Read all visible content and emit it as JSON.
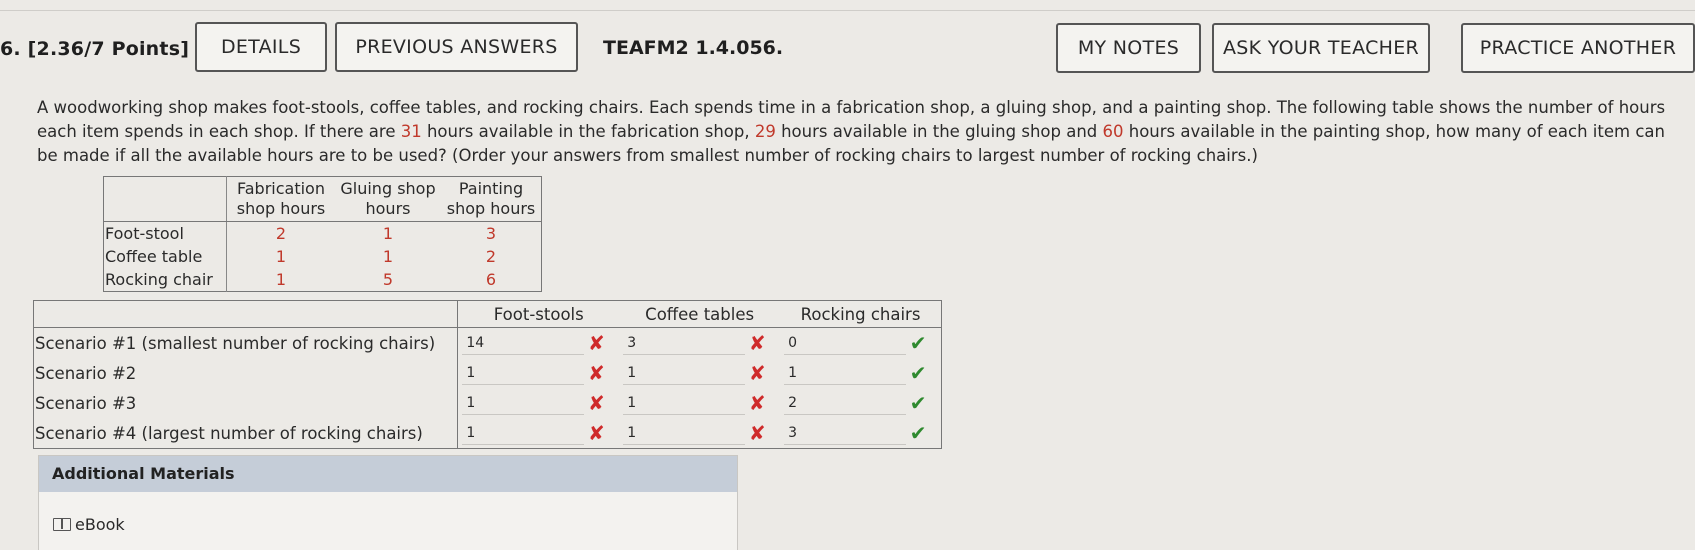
{
  "header": {
    "question_label": "6. [2.36/7 Points]",
    "details": "DETAILS",
    "previous_answers": "PREVIOUS ANSWERS",
    "problem_code": "TEAFM2 1.4.056.",
    "my_notes": "MY NOTES",
    "ask_teacher": "ASK YOUR TEACHER",
    "practice_another": "PRACTICE ANOTHER"
  },
  "prompt": {
    "p1": "A woodworking shop makes foot-stools, coffee tables, and rocking chairs. Each spends time in a fabrication shop, a gluing shop, and a painting shop. The following table shows the number of hours each item spends in each shop. If there are ",
    "fab_hours": "31",
    "p2": " hours available in the fabrication shop, ",
    "glue_hours": "29",
    "p3": " hours available in the gluing shop and ",
    "paint_hours": "60",
    "p4": " hours available in the painting shop, how many of each item can be made if all the available hours are to be used? (Order your answers from smallest number of rocking chairs to largest number of rocking chairs.)"
  },
  "hours_table": {
    "headers": [
      "Fabrication shop hours",
      "Gluing shop hours",
      "Painting shop hours"
    ],
    "rows": [
      {
        "label": "Foot-stool",
        "values": [
          "2",
          "1",
          "3"
        ]
      },
      {
        "label": "Coffee table",
        "values": [
          "1",
          "1",
          "2"
        ]
      },
      {
        "label": "Rocking chair",
        "values": [
          "1",
          "5",
          "6"
        ]
      }
    ]
  },
  "scenarios": {
    "headers": [
      "Foot-stools",
      "Coffee tables",
      "Rocking chairs"
    ],
    "rows": [
      {
        "label": "Scenario #1 (smallest number of rocking chairs)",
        "foot": "14",
        "coffee": "3",
        "rocking": "0",
        "foot_ok": false,
        "coffee_ok": false,
        "rocking_ok": true
      },
      {
        "label": "Scenario #2",
        "foot": "1",
        "coffee": "1",
        "rocking": "1",
        "foot_ok": false,
        "coffee_ok": false,
        "rocking_ok": true
      },
      {
        "label": "Scenario #3",
        "foot": "1",
        "coffee": "1",
        "rocking": "2",
        "foot_ok": false,
        "coffee_ok": false,
        "rocking_ok": true
      },
      {
        "label": "Scenario #4 (largest number of rocking chairs)",
        "foot": "1",
        "coffee": "1",
        "rocking": "3",
        "foot_ok": false,
        "coffee_ok": false,
        "rocking_ok": true
      }
    ]
  },
  "additional": {
    "title": "Additional Materials",
    "ebook": "eBook"
  },
  "icons": {
    "wrong": "x-mark-icon",
    "correct": "check-mark-icon",
    "book": "book-icon"
  },
  "colors": {
    "wrong": "#cf2b2b",
    "correct": "#2f8a2f",
    "highlight_number": "#c0392b",
    "panel_header": "#c5cdd8"
  }
}
